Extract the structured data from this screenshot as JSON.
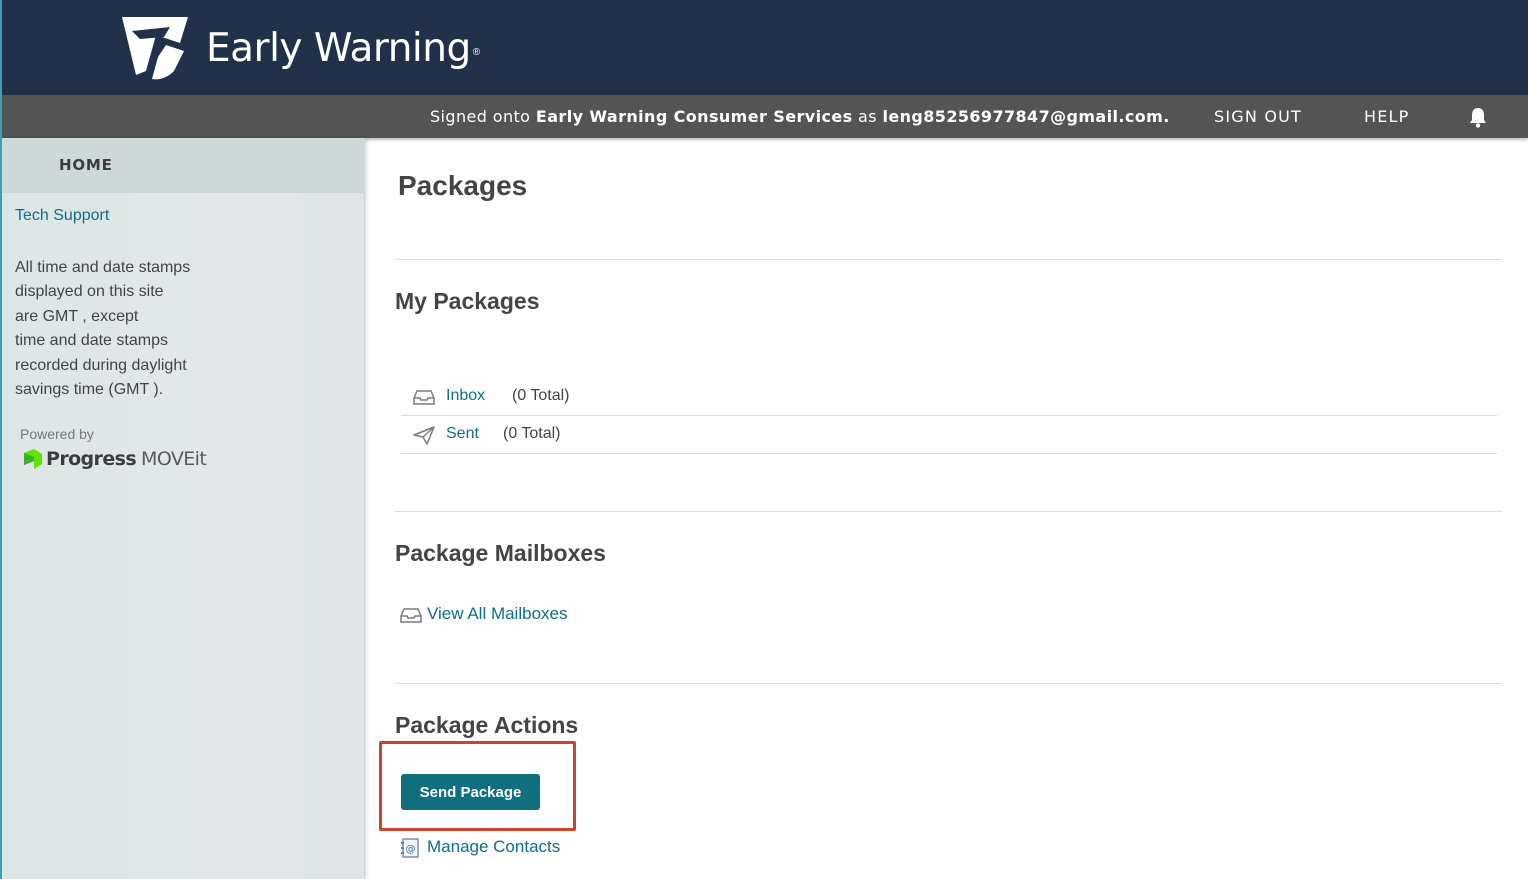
{
  "header": {
    "brand": "Early Warning",
    "brand_mark": "®",
    "logo_icon": "early-warning-logo-icon"
  },
  "topbar": {
    "signed_prefix": "Signed onto",
    "service_name": "Early Warning Consumer Services",
    "as_word": "as",
    "user_email": "leng85256977847@gmail.com.",
    "sign_out": "SIGN OUT",
    "help": "HELP",
    "bell_icon": "bell-icon"
  },
  "sidebar": {
    "home": "HOME",
    "tech_support": "Tech Support",
    "gmt_lines": [
      "All time and date stamps",
      "displayed on this site",
      "are GMT , except",
      "time and date stamps",
      "recorded during daylight",
      "savings time (GMT )."
    ],
    "powered_by": "Powered by",
    "progress": "Progress",
    "moveit": "MOVEit"
  },
  "main": {
    "title": "Packages",
    "my_packages": {
      "title": "My Packages",
      "items": [
        {
          "label": "Inbox",
          "count": "(0 Total)",
          "icon": "inbox-icon"
        },
        {
          "label": "Sent",
          "count": "(0 Total)",
          "icon": "paper-plane-icon"
        }
      ]
    },
    "mailboxes": {
      "title": "Package Mailboxes",
      "view_all": "View All Mailboxes",
      "icon": "mailbox-icon"
    },
    "actions": {
      "title": "Package Actions",
      "send_button": "Send Package",
      "manage_contacts": "Manage Contacts",
      "contacts_icon": "address-book-icon"
    }
  },
  "colors": {
    "header_bg": "#22304a",
    "topbar_bg": "#545454",
    "accent_teal": "#0f6f7e",
    "link": "#0f6f84",
    "highlight": "#d0432a"
  }
}
